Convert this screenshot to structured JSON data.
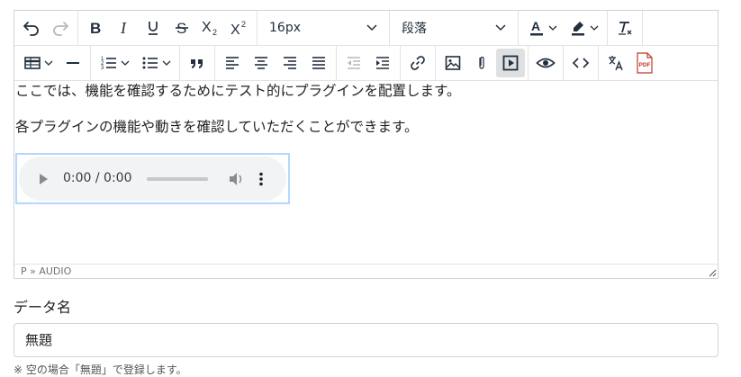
{
  "toolbar": {
    "font_size": {
      "value": "16px"
    },
    "block_format": {
      "value": "段落"
    },
    "pdf_label": "PDF",
    "icons": [
      "undo-icon",
      "redo-icon",
      "bold-icon",
      "italic-icon",
      "underline-icon",
      "strikethrough-icon",
      "subscript-icon",
      "superscript-icon",
      "text-color-icon",
      "highlight-color-icon",
      "clear-formatting-icon",
      "table-icon",
      "horizontal-line-icon",
      "numbered-list-icon",
      "bullet-list-icon",
      "blockquote-icon",
      "align-left-icon",
      "align-center-icon",
      "align-right-icon",
      "justify-icon",
      "outdent-icon",
      "indent-icon",
      "link-icon",
      "image-icon",
      "attachment-icon",
      "media-icon",
      "preview-icon",
      "source-code-icon",
      "translate-icon",
      "pdf-icon"
    ]
  },
  "content": {
    "paragraph1": "ここでは、機能を確認するためにテスト的にプラグインを配置します。",
    "paragraph2": "各プラグインの機能や動きを確認していただくことができます。",
    "audio": {
      "time": "0:00 / 0:00"
    }
  },
  "statusbar": {
    "path": "P » AUDIO"
  },
  "form": {
    "label": "データ名",
    "value": "無題",
    "note": "※ 空の場合「無題」で登録します。"
  },
  "colors": {
    "text_color_bar": "#222f3e",
    "highlight_bar": "#222f3e",
    "selection_border": "#b4d7ff",
    "pdf_red": "#c0392b"
  }
}
